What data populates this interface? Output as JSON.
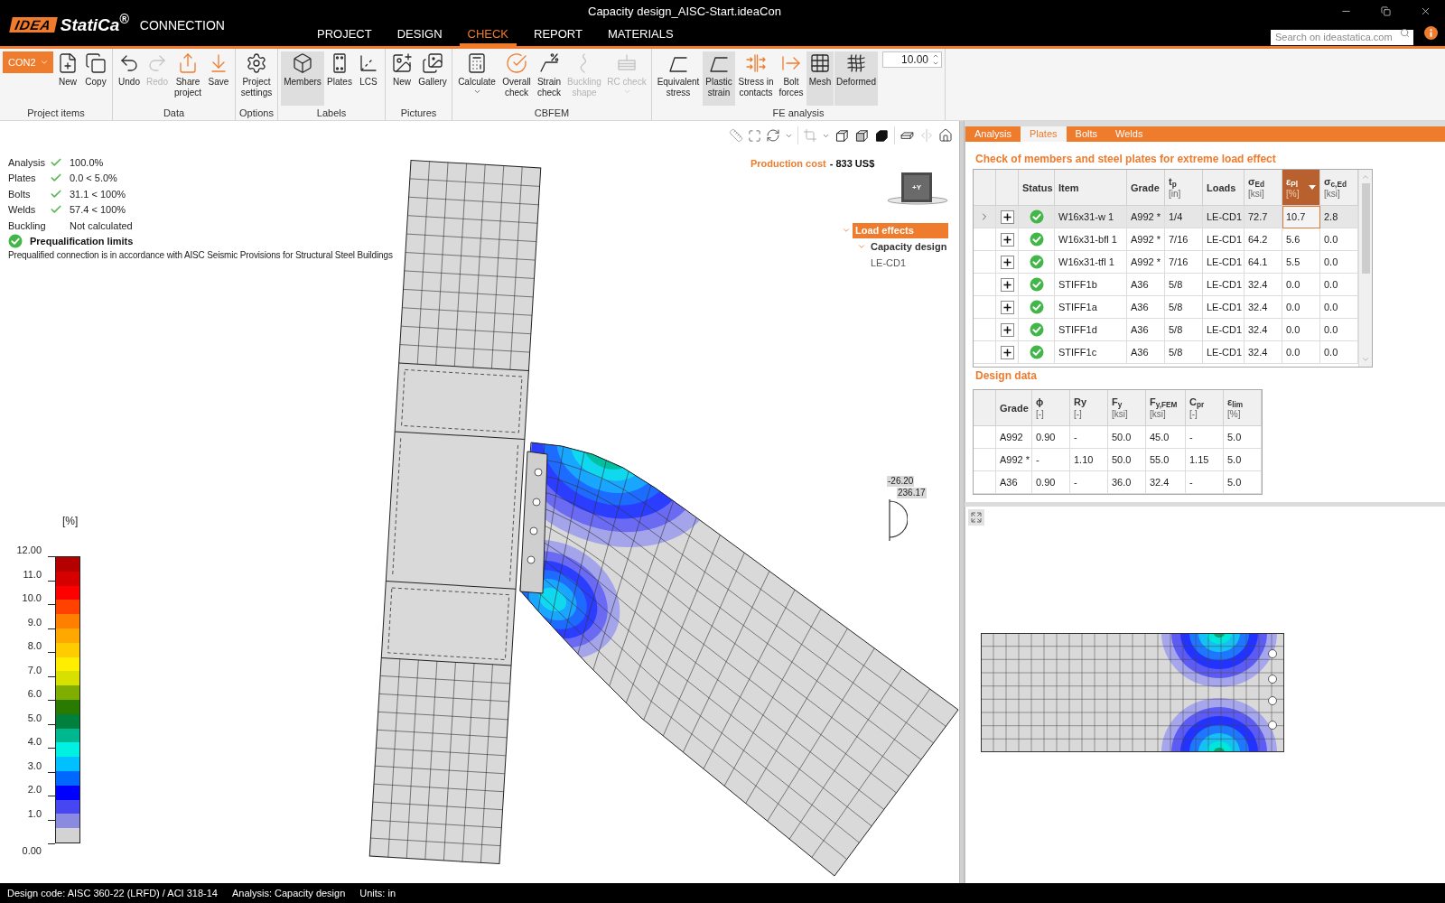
{
  "window": {
    "title": "Capacity design_AISC-Start.ideaCon"
  },
  "logo": {
    "mark": "IDEA",
    "name": "StatiCa$^{®}$",
    "product": "CONNECTION"
  },
  "menu_tabs": [
    {
      "label": "PROJECT",
      "selected": false
    },
    {
      "label": "DESIGN",
      "selected": false
    },
    {
      "label": "CHECK",
      "selected": true
    },
    {
      "label": "REPORT",
      "selected": false
    },
    {
      "label": "MATERIALS",
      "selected": false
    }
  ],
  "search": {
    "placeholder": "Search on ideastatica.com"
  },
  "ribbon": {
    "groups": [
      {
        "label": "Project items",
        "items": [
          {
            "kind": "dropdown",
            "label": "CON2"
          },
          {
            "kind": "button",
            "label": "New",
            "selected": false,
            "disabled": false
          },
          {
            "kind": "button",
            "label": "Copy",
            "selected": false,
            "disabled": false
          }
        ]
      },
      {
        "label": "Data",
        "items": [
          {
            "kind": "button",
            "label": "Undo",
            "selected": false,
            "disabled": false
          },
          {
            "kind": "button",
            "label": "Redo",
            "selected": false,
            "disabled": true
          },
          {
            "kind": "button",
            "label": "Share project",
            "selected": false,
            "disabled": false
          },
          {
            "kind": "button",
            "label": "Save",
            "selected": false,
            "disabled": false
          }
        ]
      },
      {
        "label": "Options",
        "items": [
          {
            "kind": "button",
            "label": "Project settings",
            "selected": false,
            "disabled": false
          }
        ]
      },
      {
        "label": "Labels",
        "items": [
          {
            "kind": "button",
            "label": "Members",
            "selected": true,
            "disabled": false
          },
          {
            "kind": "button",
            "label": "Plates",
            "selected": false,
            "disabled": false
          },
          {
            "kind": "button",
            "label": "LCS",
            "selected": false,
            "disabled": false
          }
        ]
      },
      {
        "label": "Pictures",
        "items": [
          {
            "kind": "button",
            "label": "New",
            "selected": false,
            "disabled": false
          },
          {
            "kind": "button",
            "label": "Gallery",
            "selected": false,
            "disabled": false
          }
        ]
      },
      {
        "label": "CBFEM",
        "items": [
          {
            "kind": "menu",
            "label": "Calculate",
            "selected": false,
            "disabled": false
          },
          {
            "kind": "button",
            "label": "Overall check",
            "selected": false,
            "disabled": false
          },
          {
            "kind": "button",
            "label": "Strain check",
            "selected": false,
            "disabled": false
          },
          {
            "kind": "button",
            "label": "Buckling shape",
            "selected": false,
            "disabled": true
          },
          {
            "kind": "menu",
            "label": "RC check",
            "selected": false,
            "disabled": true
          }
        ]
      },
      {
        "label": "FE analysis",
        "items": [
          {
            "kind": "button",
            "label": "Equivalent stress",
            "selected": false,
            "disabled": false
          },
          {
            "kind": "button",
            "label": "Plastic strain",
            "selected": true,
            "disabled": false
          },
          {
            "kind": "button",
            "label": "Stress in contacts",
            "selected": false,
            "disabled": false
          },
          {
            "kind": "button",
            "label": "Bolt forces",
            "selected": false,
            "disabled": false
          },
          {
            "kind": "button",
            "label": "Mesh",
            "selected": true,
            "disabled": false
          },
          {
            "kind": "button",
            "label": "Deformed",
            "selected": true,
            "disabled": false
          },
          {
            "kind": "spinner",
            "value": "10.00"
          }
        ]
      }
    ]
  },
  "summary": {
    "items": [
      {
        "label": "Analysis",
        "ok": true,
        "value": "100.0%"
      },
      {
        "label": "Plates",
        "ok": true,
        "value": "0.0 < 5.0%"
      },
      {
        "label": "Bolts",
        "ok": true,
        "value": "31.1 < 100%"
      },
      {
        "label": "Welds",
        "ok": true,
        "value": "57.4 < 100%"
      },
      {
        "label": "Buckling",
        "ok": false,
        "value": "Not calculated"
      }
    ],
    "prequalification": {
      "ok": true,
      "title": "Prequalification limits",
      "text": "Prequalified connection is in accordance with AISC Seismic Provisions for Structural Steel Buildings"
    }
  },
  "production_cost": {
    "label": "Production cost",
    "value": "- 833 US$"
  },
  "view_cube": {
    "face": "+Y"
  },
  "load_effects": [
    {
      "label": "Load effects",
      "selected": true,
      "expanded": true,
      "children": [
        {
          "label": "Capacity design",
          "selected": false,
          "expanded": true,
          "children": [
            {
              "label": "LE-CD1",
              "selected": false
            }
          ]
        }
      ]
    }
  ],
  "angle_readings": [
    "-26.20",
    "236.17"
  ],
  "legend": {
    "unit": "[%]",
    "ticks": [
      "12.00",
      "11.0",
      "10.0",
      "9.0",
      "8.0",
      "7.0",
      "6.0",
      "5.0",
      "4.0",
      "3.0",
      "2.0",
      "1.0",
      "0.00"
    ],
    "bands": [
      {
        "color": "#b40000"
      },
      {
        "color": "#d60000"
      },
      {
        "color": "#ff0000"
      },
      {
        "color": "#ff4200"
      },
      {
        "color": "#ff8000"
      },
      {
        "color": "#ffa800"
      },
      {
        "color": "#ffcc00"
      },
      {
        "color": "#ffee00"
      },
      {
        "color": "#d8e000"
      },
      {
        "color": "#80ae00"
      },
      {
        "color": "#2a7a00"
      },
      {
        "color": "#00803c"
      },
      {
        "color": "#00b890"
      },
      {
        "color": "#00f0e2"
      },
      {
        "color": "#00c0ff"
      },
      {
        "color": "#0068ff"
      },
      {
        "color": "#0000ff"
      },
      {
        "color": "#4646f2"
      },
      {
        "color": "#8a8ae0"
      },
      {
        "color": "#d3d3d3"
      }
    ]
  },
  "panel_tabs": [
    {
      "label": "Analysis",
      "selected": false
    },
    {
      "label": "Plates",
      "selected": true
    },
    {
      "label": "Bolts",
      "selected": false
    },
    {
      "label": "Welds",
      "selected": false
    }
  ],
  "plates_check": {
    "title": "Check of members and steel plates for extreme load effect",
    "columns": [
      {
        "label": "Status",
        "sorted": false
      },
      {
        "label": "Item",
        "sorted": false
      },
      {
        "label": "Grade",
        "sorted": false
      },
      {
        "label": "t$_{p}$",
        "unit": "[in]",
        "sorted": false
      },
      {
        "label": "Loads",
        "sorted": false
      },
      {
        "label": "σ$_{Ed}$",
        "unit": "[ksi]",
        "sorted": false
      },
      {
        "label": "ε$_{Pl}$",
        "unit": "[%]",
        "sorted": true
      },
      {
        "label": "σ$_{c,Ed}$",
        "unit": "[ksi]",
        "sorted": false
      }
    ],
    "rows": [
      {
        "selected": true,
        "ok": true,
        "cells": [
          "",
          "W16x31-w 1",
          "A992 *",
          "1/4",
          "LE-CD1",
          "72.7",
          "10.7",
          "2.8"
        ]
      },
      {
        "selected": false,
        "ok": true,
        "cells": [
          "",
          "W16x31-bfl 1",
          "A992 *",
          "7/16",
          "LE-CD1",
          "64.2",
          "5.6",
          "0.0"
        ]
      },
      {
        "selected": false,
        "ok": true,
        "cells": [
          "",
          "W16x31-tfl 1",
          "A992 *",
          "7/16",
          "LE-CD1",
          "64.1",
          "5.5",
          "0.0"
        ]
      },
      {
        "selected": false,
        "ok": true,
        "cells": [
          "",
          "STIFF1b",
          "A36",
          "5/8",
          "LE-CD1",
          "32.4",
          "0.0",
          "0.0"
        ]
      },
      {
        "selected": false,
        "ok": true,
        "cells": [
          "",
          "STIFF1a",
          "A36",
          "5/8",
          "LE-CD1",
          "32.4",
          "0.0",
          "0.0"
        ]
      },
      {
        "selected": false,
        "ok": true,
        "cells": [
          "",
          "STIFF1d",
          "A36",
          "5/8",
          "LE-CD1",
          "32.4",
          "0.0",
          "0.0"
        ]
      },
      {
        "selected": false,
        "ok": true,
        "cells": [
          "",
          "STIFF1c",
          "A36",
          "5/8",
          "LE-CD1",
          "32.4",
          "0.0",
          "0.0"
        ]
      }
    ]
  },
  "design_data": {
    "title": "Design data",
    "columns": [
      {
        "label": "Grade"
      },
      {
        "label": "ϕ",
        "unit": "[-]"
      },
      {
        "label": "Ry",
        "unit": "[-]"
      },
      {
        "label": "F$_{y}$",
        "unit": "[ksi]"
      },
      {
        "label": "F$_{y,FEM}$",
        "unit": "[ksi]"
      },
      {
        "label": "C$_{pr}$",
        "unit": "[-]"
      },
      {
        "label": "ε$_{lim}$",
        "unit": "[%]"
      }
    ],
    "rows": [
      [
        "A992",
        "0.90",
        "-",
        "50.0",
        "45.0",
        "-",
        "5.0"
      ],
      [
        "A992 *",
        "-",
        "1.10",
        "50.0",
        "55.0",
        "1.15",
        "5.0"
      ],
      [
        "A36",
        "0.90",
        "-",
        "36.0",
        "32.4",
        "-",
        "5.0"
      ]
    ]
  },
  "status_bar": [
    "Design code: AISC 360-22 (LRFD) / ACI 318-14",
    "Analysis: Capacity design",
    "Units: in"
  ]
}
